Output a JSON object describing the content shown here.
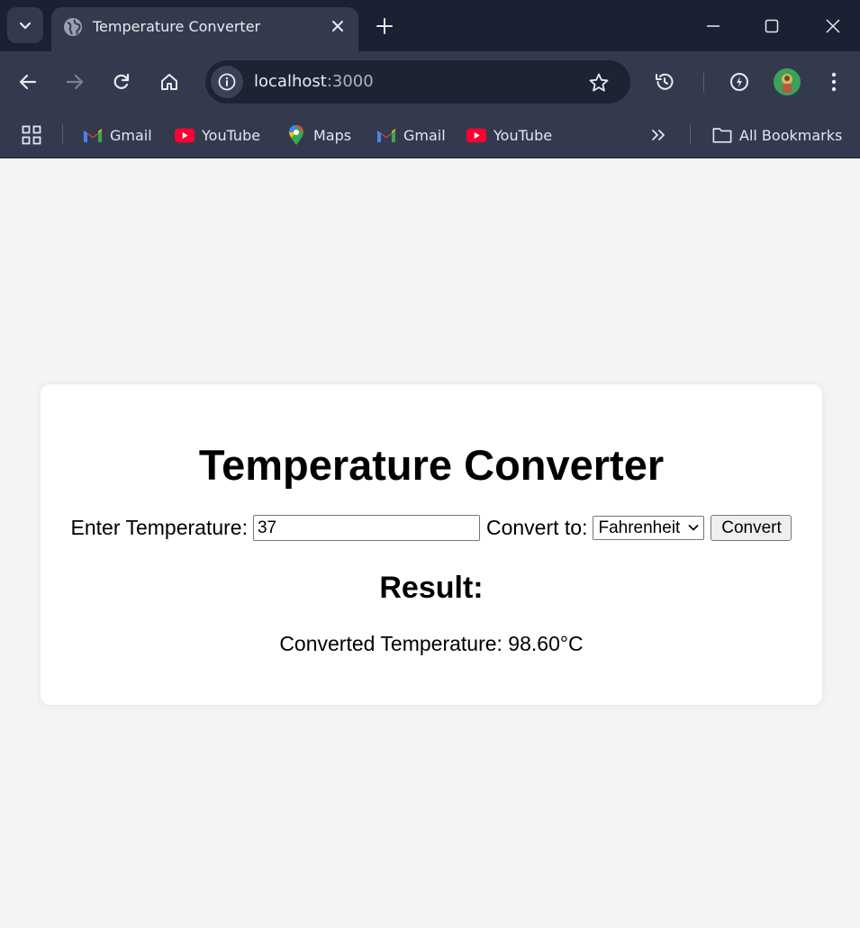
{
  "browser": {
    "tab": {
      "title": "Temperature Converter",
      "favicon": "globe-icon"
    },
    "address": {
      "host": "localhost",
      "port": ":3000"
    },
    "bookmarks": [
      {
        "label": "Gmail",
        "icon": "gmail-icon"
      },
      {
        "label": "YouTube",
        "icon": "youtube-icon"
      },
      {
        "label": "Maps",
        "icon": "maps-icon"
      },
      {
        "label": "Gmail",
        "icon": "gmail-icon"
      },
      {
        "label": "YouTube",
        "icon": "youtube-icon"
      }
    ],
    "all_bookmarks_label": "All Bookmarks",
    "colors": {
      "tabstrip": "#1b2033",
      "toolbar": "#343a4e",
      "omnibox": "#1e2334"
    }
  },
  "app": {
    "title": "Temperature Converter",
    "input_label": "Enter Temperature:",
    "input_value": "37",
    "convert_to_label": "Convert to:",
    "selected_unit": "Fahrenheit",
    "convert_button": "Convert",
    "result_heading": "Result:",
    "result_text": "Converted Temperature: 98.60°C"
  }
}
